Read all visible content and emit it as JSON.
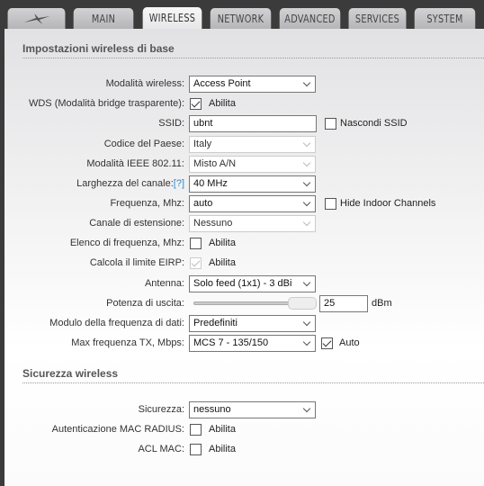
{
  "tabs": [
    {
      "label": "MAIN"
    },
    {
      "label": "WIRELESS",
      "active": true
    },
    {
      "label": "NETWORK"
    },
    {
      "label": "ADVANCED"
    },
    {
      "label": "SERVICES"
    },
    {
      "label": "SYSTEM"
    }
  ],
  "logo": "ubiquiti-logo-icon",
  "basic": {
    "title": "Impostazioni wireless di base",
    "mode_label": "Modalità wireless:",
    "mode_value": "Access Point",
    "wds_label": "WDS (Modalità bridge trasparente):",
    "wds_text": "Abilita",
    "wds_checked": true,
    "ssid_label": "SSID:",
    "ssid_value": "ubnt",
    "hide_ssid_text": "Nascondi SSID",
    "hide_ssid_checked": false,
    "country_label": "Codice del Paese:",
    "country_value": "Italy",
    "ieee_label": "Modalità IEEE 802.11:",
    "ieee_value": "Misto A/N",
    "width_label": "Larghezza del canale:",
    "width_help": "[?]",
    "width_value": "40 MHz",
    "freq_label": "Frequenza, Mhz:",
    "freq_value": "auto",
    "hide_indoor_text": "Hide Indoor Channels",
    "hide_indoor_checked": false,
    "ext_label": "Canale di estensione:",
    "ext_value": "Nessuno",
    "freqlist_label": "Elenco di frequenza, Mhz:",
    "freqlist_text": "Abilita",
    "freqlist_checked": false,
    "eirp_label": "Calcola il limite EIRP:",
    "eirp_text": "Abilita",
    "eirp_checked": true,
    "antenna_label": "Antenna:",
    "antenna_value": "Solo feed (1x1) - 3 dBi",
    "power_label": "Potenza di uscita:",
    "power_value": "25",
    "power_unit": "dBm",
    "power_slider_fraction": 1.0,
    "rate_module_label": "Modulo della frequenza di dati:",
    "rate_module_value": "Predefiniti",
    "maxtx_label": "Max frequenza TX, Mbps:",
    "maxtx_value": "MCS 7 - 135/150",
    "maxtx_auto_text": "Auto",
    "maxtx_auto_checked": true
  },
  "security": {
    "title": "Sicurezza wireless",
    "sec_label": "Sicurezza:",
    "sec_value": "nessuno",
    "radius_label": "Autenticazione MAC RADIUS:",
    "radius_text": "Abilita",
    "radius_checked": false,
    "acl_label": "ACL MAC:",
    "acl_text": "Abilita",
    "acl_checked": false
  }
}
